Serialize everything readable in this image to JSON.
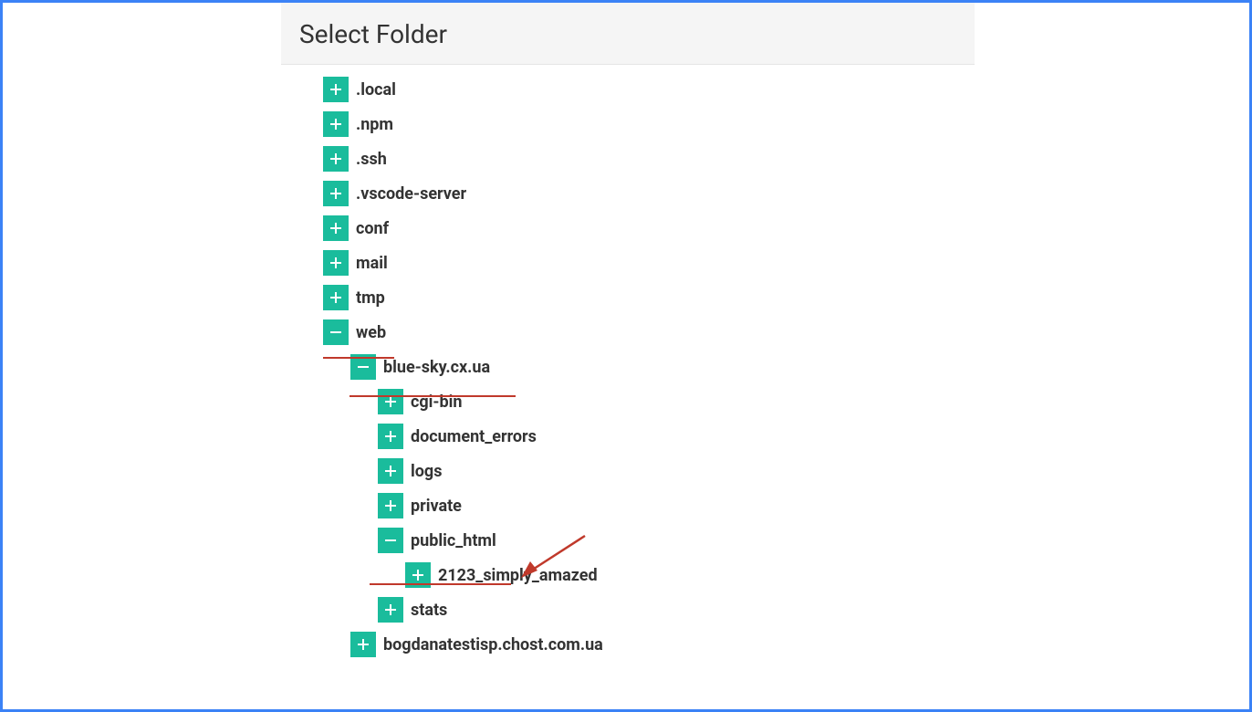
{
  "dialog": {
    "title": "Select Folder"
  },
  "nodes": {
    "local": {
      "label": ".local",
      "expanded": false
    },
    "npm": {
      "label": ".npm",
      "expanded": false
    },
    "ssh": {
      "label": ".ssh",
      "expanded": false
    },
    "vscode": {
      "label": ".vscode-server",
      "expanded": false
    },
    "conf": {
      "label": "conf",
      "expanded": false
    },
    "mail": {
      "label": "mail",
      "expanded": false
    },
    "tmp": {
      "label": "tmp",
      "expanded": false
    },
    "web": {
      "label": "web",
      "expanded": true
    },
    "bluesky": {
      "label": "blue-sky.cx.ua",
      "expanded": true
    },
    "cgibin": {
      "label": "cgi-bin",
      "expanded": false
    },
    "docerrors": {
      "label": "document_errors",
      "expanded": false
    },
    "logs": {
      "label": "logs",
      "expanded": false
    },
    "private": {
      "label": "private",
      "expanded": false
    },
    "publichtml": {
      "label": "public_html",
      "expanded": true
    },
    "simplyamazed": {
      "label": "2123_simply_amazed",
      "expanded": false
    },
    "stats": {
      "label": "stats",
      "expanded": false
    },
    "bogdana": {
      "label": "bogdanatestisp.chost.com.ua",
      "expanded": false
    }
  }
}
